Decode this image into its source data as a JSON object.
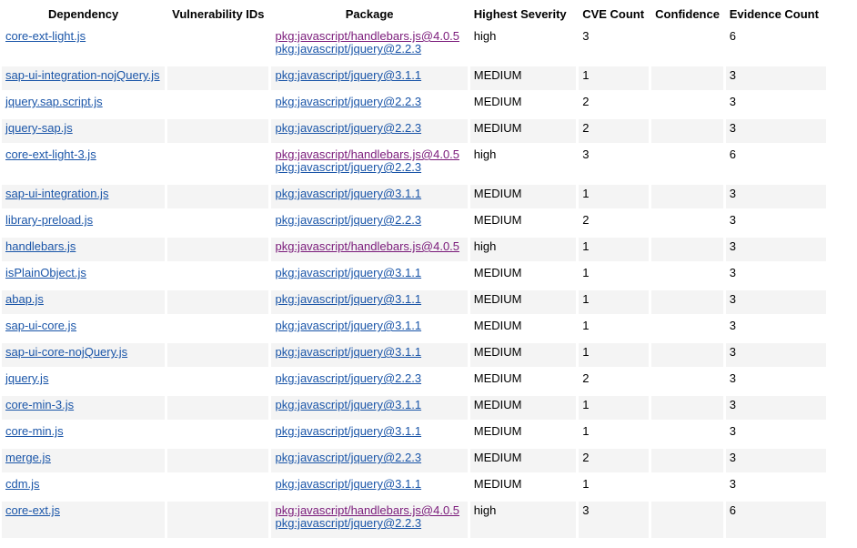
{
  "columns": [
    "Dependency",
    "Vulnerability IDs",
    "Package",
    "Highest Severity",
    "CVE Count",
    "Confidence",
    "Evidence Count"
  ],
  "rows": [
    {
      "dependency": "core-ext-light.js",
      "vulnerability_ids": "",
      "packages": [
        "pkg:javascript/handlebars.js@4.0.5",
        "pkg:javascript/jquery@2.2.3"
      ],
      "severity": "high",
      "cve_count": "3",
      "confidence": "",
      "evidence_count": "6"
    },
    {
      "dependency": "sap-ui-integration-nojQuery.js",
      "vulnerability_ids": "",
      "packages": [
        "pkg:javascript/jquery@3.1.1"
      ],
      "severity": "MEDIUM",
      "cve_count": "1",
      "confidence": "",
      "evidence_count": "3"
    },
    {
      "dependency": "jquery.sap.script.js",
      "vulnerability_ids": "",
      "packages": [
        "pkg:javascript/jquery@2.2.3"
      ],
      "severity": "MEDIUM",
      "cve_count": "2",
      "confidence": "",
      "evidence_count": "3"
    },
    {
      "dependency": "jquery-sap.js",
      "vulnerability_ids": "",
      "packages": [
        "pkg:javascript/jquery@2.2.3"
      ],
      "severity": "MEDIUM",
      "cve_count": "2",
      "confidence": "",
      "evidence_count": "3"
    },
    {
      "dependency": "core-ext-light-3.js",
      "vulnerability_ids": "",
      "packages": [
        "pkg:javascript/handlebars.js@4.0.5",
        "pkg:javascript/jquery@2.2.3"
      ],
      "severity": "high",
      "cve_count": "3",
      "confidence": "",
      "evidence_count": "6"
    },
    {
      "dependency": "sap-ui-integration.js",
      "vulnerability_ids": "",
      "packages": [
        "pkg:javascript/jquery@3.1.1"
      ],
      "severity": "MEDIUM",
      "cve_count": "1",
      "confidence": "",
      "evidence_count": "3"
    },
    {
      "dependency": "library-preload.js",
      "vulnerability_ids": "",
      "packages": [
        "pkg:javascript/jquery@2.2.3"
      ],
      "severity": "MEDIUM",
      "cve_count": "2",
      "confidence": "",
      "evidence_count": "3"
    },
    {
      "dependency": "handlebars.js",
      "vulnerability_ids": "",
      "packages": [
        "pkg:javascript/handlebars.js@4.0.5"
      ],
      "severity": "high",
      "cve_count": "1",
      "confidence": "",
      "evidence_count": "3"
    },
    {
      "dependency": "isPlainObject.js",
      "vulnerability_ids": "",
      "packages": [
        "pkg:javascript/jquery@3.1.1"
      ],
      "severity": "MEDIUM",
      "cve_count": "1",
      "confidence": "",
      "evidence_count": "3"
    },
    {
      "dependency": "abap.js",
      "vulnerability_ids": "",
      "packages": [
        "pkg:javascript/jquery@3.1.1"
      ],
      "severity": "MEDIUM",
      "cve_count": "1",
      "confidence": "",
      "evidence_count": "3"
    },
    {
      "dependency": "sap-ui-core.js",
      "vulnerability_ids": "",
      "packages": [
        "pkg:javascript/jquery@3.1.1"
      ],
      "severity": "MEDIUM",
      "cve_count": "1",
      "confidence": "",
      "evidence_count": "3"
    },
    {
      "dependency": "sap-ui-core-nojQuery.js",
      "vulnerability_ids": "",
      "packages": [
        "pkg:javascript/jquery@3.1.1"
      ],
      "severity": "MEDIUM",
      "cve_count": "1",
      "confidence": "",
      "evidence_count": "3"
    },
    {
      "dependency": "jquery.js",
      "vulnerability_ids": "",
      "packages": [
        "pkg:javascript/jquery@2.2.3"
      ],
      "severity": "MEDIUM",
      "cve_count": "2",
      "confidence": "",
      "evidence_count": "3"
    },
    {
      "dependency": "core-min-3.js",
      "vulnerability_ids": "",
      "packages": [
        "pkg:javascript/jquery@3.1.1"
      ],
      "severity": "MEDIUM",
      "cve_count": "1",
      "confidence": "",
      "evidence_count": "3"
    },
    {
      "dependency": "core-min.js",
      "vulnerability_ids": "",
      "packages": [
        "pkg:javascript/jquery@3.1.1"
      ],
      "severity": "MEDIUM",
      "cve_count": "1",
      "confidence": "",
      "evidence_count": "3"
    },
    {
      "dependency": "merge.js",
      "vulnerability_ids": "",
      "packages": [
        "pkg:javascript/jquery@2.2.3"
      ],
      "severity": "MEDIUM",
      "cve_count": "2",
      "confidence": "",
      "evidence_count": "3"
    },
    {
      "dependency": "cdm.js",
      "vulnerability_ids": "",
      "packages": [
        "pkg:javascript/jquery@3.1.1"
      ],
      "severity": "MEDIUM",
      "cve_count": "1",
      "confidence": "",
      "evidence_count": "3"
    },
    {
      "dependency": "core-ext.js",
      "vulnerability_ids": "",
      "packages": [
        "pkg:javascript/handlebars.js@4.0.5",
        "pkg:javascript/jquery@2.2.3"
      ],
      "severity": "high",
      "cve_count": "3",
      "confidence": "",
      "evidence_count": "6"
    }
  ],
  "colors": {
    "link": "#1a55a8",
    "handlebars_link": "#7a1a7a",
    "row_shade": "#f4f4f4"
  }
}
